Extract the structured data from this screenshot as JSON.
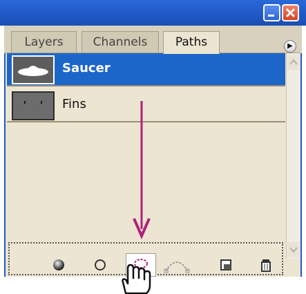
{
  "tabs": [
    "Layers",
    "Channels",
    "Paths"
  ],
  "active_tab": "Paths",
  "paths": [
    {
      "name": "Saucer",
      "selected": true
    },
    {
      "name": "Fins",
      "selected": false
    }
  ],
  "toolbar_icons": [
    "fill-path-icon",
    "stroke-path-icon",
    "load-path-as-selection-icon",
    "make-work-path-icon",
    "create-new-path-icon",
    "delete-path-icon"
  ],
  "colors": {
    "title_bar": "#1f58c4",
    "selection": "#1c66c8",
    "panel_background": "#ece5d2",
    "annotation_arrow": "#b01f7a"
  }
}
